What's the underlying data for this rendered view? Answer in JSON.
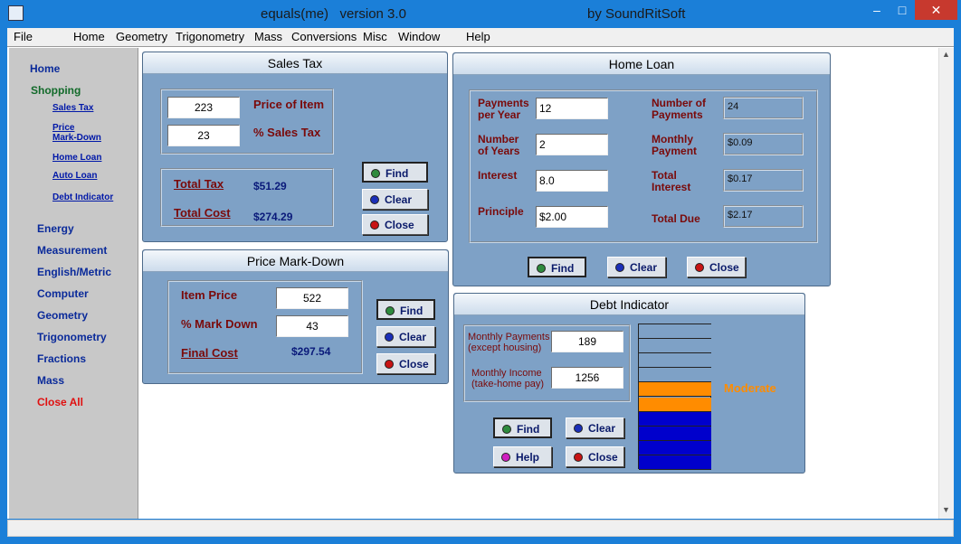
{
  "app": {
    "title": "equals(me)   version 3.0",
    "author": "by SoundRitSoft",
    "minimize": "–",
    "restore": "□",
    "close": "✕"
  },
  "menu": [
    "File",
    "Home",
    "Geometry",
    "Trigonometry",
    "Mass",
    "Conversions",
    "Misc",
    "Window",
    "Help"
  ],
  "sidebar": {
    "home": "Home",
    "shopping": "Shopping",
    "sub_items": [
      "Sales Tax",
      "Price\nMark-Down",
      "Home Loan",
      "Auto Loan",
      "Debt Indicator"
    ],
    "items": [
      "Energy",
      "Measurement",
      "English/Metric",
      "Computer",
      "Geometry",
      "Trigonometry",
      "Fractions",
      "Mass"
    ],
    "close_all": "Close All"
  },
  "sales_tax": {
    "title": "Sales Tax",
    "price_value": "223",
    "price_label": "Price of Item",
    "tax_value": "23",
    "tax_label": "% Sales Tax",
    "total_tax_label": "Total Tax",
    "total_tax_value": "$51.29",
    "total_cost_label": "Total Cost",
    "total_cost_value": "$274.29",
    "find": "Find",
    "clear": "Clear",
    "close": "Close"
  },
  "price_markdown": {
    "title": "Price Mark-Down",
    "item_price_label": "Item Price",
    "item_price_value": "522",
    "markdown_label": "% Mark Down",
    "markdown_value": "43",
    "final_cost_label": "Final Cost",
    "final_cost_value": "$297.54",
    "find": "Find",
    "clear": "Clear",
    "close": "Close"
  },
  "home_loan": {
    "title": "Home Loan",
    "payments_per_year_label": "Payments\nper Year",
    "payments_per_year_value": "12",
    "years_label": "Number\nof Years",
    "years_value": "2",
    "interest_label": "Interest",
    "interest_value": "8.0",
    "principle_label": "Principle",
    "principle_value": "$2.00",
    "num_payments_label": "Number of\nPayments",
    "num_payments_value": "24",
    "monthly_label": "Monthly\nPayment",
    "monthly_value": "$0.09",
    "total_interest_label": "Total\nInterest",
    "total_interest_value": "$0.17",
    "total_due_label": "Total Due",
    "total_due_value": "$2.17",
    "find": "Find",
    "clear": "Clear",
    "close": "Close"
  },
  "debt_indicator": {
    "title": "Debt Indicator",
    "monthly_payments_label": "Monthly Payments\n(except housing)",
    "monthly_payments_value": "189",
    "monthly_income_label": "Monthly Income\n(take-home pay)",
    "monthly_income_value": "1256",
    "status": "Moderate",
    "find": "Find",
    "clear": "Clear",
    "help": "Help",
    "close": "Close",
    "meter_segments": [
      "empty",
      "empty",
      "empty",
      "empty",
      "orange",
      "orange",
      "blue",
      "blue",
      "blue",
      "blue"
    ]
  },
  "colors": {
    "green_dot": "#2e8b3e",
    "blue_dot": "#1b2fb8",
    "red_dot": "#c81414",
    "magenta_dot": "#d020c0",
    "orange": "#ff8c00",
    "blue": "#0000cc",
    "panel": "#7ea1c6"
  }
}
